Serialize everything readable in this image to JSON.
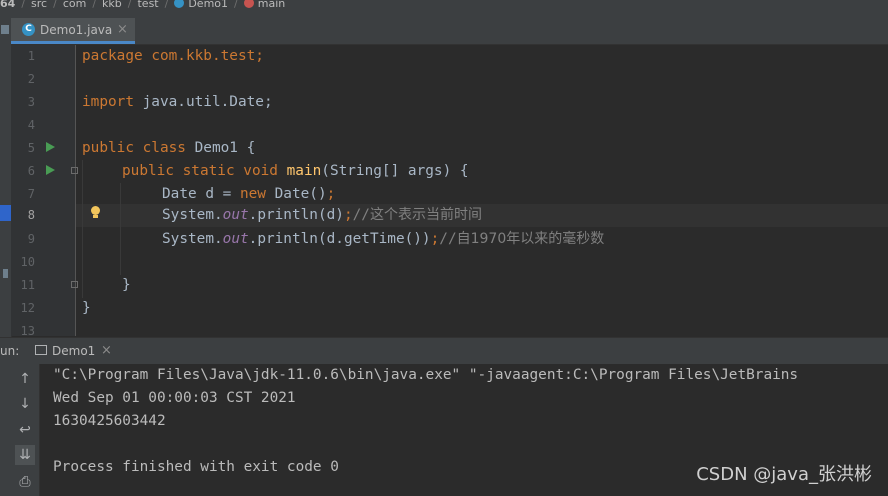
{
  "breadcrumb": {
    "items": [
      "64",
      "src",
      "com",
      "kkb",
      "test",
      "Demo1",
      "main"
    ]
  },
  "tab": {
    "label": "Demo1.java",
    "close": "×",
    "icon_letter": "C"
  },
  "editor": {
    "line_numbers": [
      "1",
      "2",
      "3",
      "4",
      "5",
      "6",
      "7",
      "8",
      "9",
      "10",
      "11",
      "12",
      "13"
    ],
    "lines": {
      "l1_kw": "package",
      "l1_rest": " com.kkb.test;",
      "l3_kw": "import",
      "l3_rest": " java.util.Date;",
      "l5_kw": "public class",
      "l5_rest": " Demo1 {",
      "l6_kw": "public static void",
      "l6_fn": "main",
      "l6_rest": "(String[] args) {",
      "l7_a": "Date d = ",
      "l7_kw": "new",
      "l7_b": " Date()",
      "l7_semi": ";",
      "l8_a": "System.",
      "l8_field": "out",
      "l8_b": ".println(d)",
      "l8_semi": ";",
      "l8_cmt": "//",
      "l8_cmt_cn": "这个表示当前时间",
      "l9_a": "System.",
      "l9_field": "out",
      "l9_b": ".println(d.getTime())",
      "l9_semi": ";",
      "l9_cmt": "//",
      "l9_cmt_cn": "自1970年以来的毫秒数",
      "l11": "}",
      "l12": "}"
    }
  },
  "run_panel": {
    "label": "un:",
    "tab_label": "Demo1",
    "tab_close": "×",
    "console": [
      "\"C:\\Program Files\\Java\\jdk-11.0.6\\bin\\java.exe\" \"-javaagent:C:\\Program Files\\JetBrains",
      "Wed Sep 01 00:00:03 CST 2021",
      "1630425603442",
      "",
      "Process finished with exit code 0"
    ]
  },
  "watermark": "CSDN @java_张洪彬",
  "colors": {
    "keyword": "#cc7832",
    "function": "#ffc66d",
    "field": "#9876aa",
    "comment": "#808080",
    "run_arrow": "#499c54",
    "accent": "#4a88c7"
  },
  "icons": [
    "class-icon",
    "method-icon",
    "run-arrow-icon",
    "fold-icon",
    "lightbulb-icon",
    "console-icon",
    "up-arrow-icon",
    "down-arrow-icon",
    "soft-wrap-icon",
    "scroll-to-end-icon",
    "print-icon"
  ]
}
